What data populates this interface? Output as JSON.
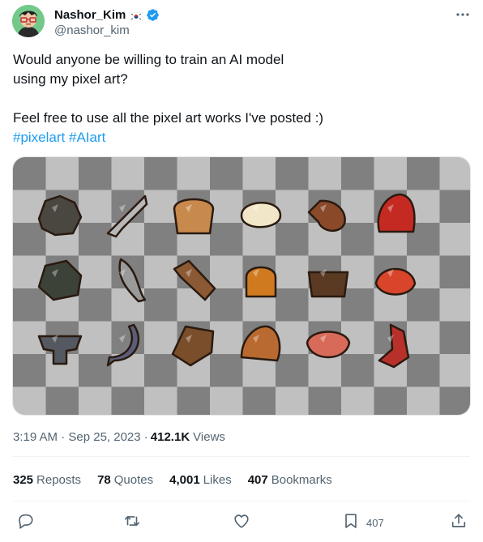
{
  "author": {
    "display_name": "Nashor_Kim",
    "handle": "@nashor_kim",
    "flag_icon": "south-korea-flag-icon",
    "verified_icon": "verified-badge-icon",
    "verified_color": "#1d9bf0"
  },
  "tweet": {
    "line1": "Would anyone be willing to train an AI model",
    "line2": "using my pixel art?",
    "line3": "Feel free to use all the pixel art works I've posted :)",
    "hashtags": [
      "#pixelart",
      "#AIart"
    ]
  },
  "media": {
    "description_icon": "pixel-art-sprite-sheet-image",
    "sprites": [
      "tangled-root",
      "sword",
      "bread-slice",
      "fried-egg",
      "roast-drumstick",
      "red-hood",
      "stone-golem",
      "curved-dagger",
      "wooden-log",
      "potion-flask",
      "stew-pot",
      "red-crab",
      "anvil",
      "sickle",
      "dry-leaf",
      "straw-tuft",
      "raw-steak",
      "red-horn"
    ]
  },
  "meta": {
    "time_date": "3:19 AM · Sep 25, 2023 ·",
    "views_count": "412.1K",
    "views_label": "Views"
  },
  "stats": {
    "reposts_count": "325",
    "reposts_label": "Reposts",
    "quotes_count": "78",
    "quotes_label": "Quotes",
    "likes_count": "4,001",
    "likes_label": "Likes",
    "bookmarks_count": "407",
    "bookmarks_label": "Bookmarks"
  },
  "actions": {
    "reply_icon": "reply-icon",
    "repost_icon": "repost-icon",
    "like_icon": "heart-icon",
    "bookmark_icon": "bookmark-icon",
    "bookmark_count": "407",
    "share_icon": "share-icon"
  },
  "colors": {
    "accent": "#1d9bf0",
    "text": "#0f1419",
    "secondary": "#536471",
    "checker_dark": "#808080",
    "checker_light": "#c0c0c0"
  }
}
